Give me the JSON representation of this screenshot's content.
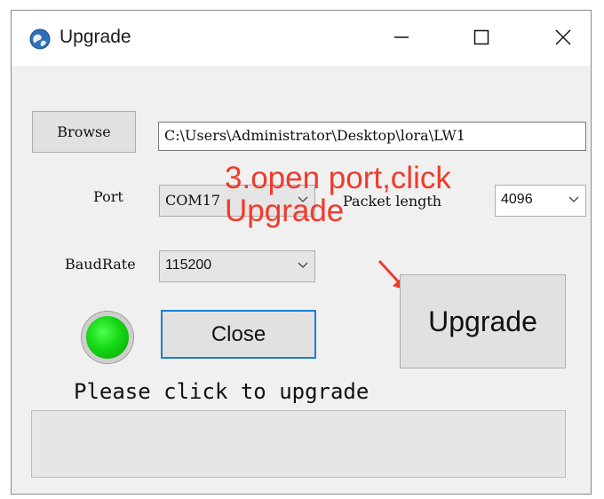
{
  "window": {
    "title": "Upgrade",
    "icons": {
      "app": "globe-icon",
      "minimize": "minimize-icon",
      "maximize": "maximize-icon",
      "close": "close-icon"
    }
  },
  "file": {
    "browse_label": "Browse",
    "path": "C:\\Users\\Administrator\\Desktop\\lora\\LW1"
  },
  "port": {
    "label": "Port",
    "value": "COM17"
  },
  "packet_length": {
    "label": "Packet length",
    "value": "4096"
  },
  "baud_rate": {
    "label": "BaudRate",
    "value": "115200"
  },
  "annotation": {
    "text": "3.open port,click Upgrade",
    "color": "#f03a2c"
  },
  "actions": {
    "upgrade_label": "Upgrade",
    "close_label": "Close"
  },
  "status": {
    "connected": true,
    "indicator_color": "#15d615",
    "message": "Please click to upgrade"
  },
  "progress": {
    "value": 0
  }
}
